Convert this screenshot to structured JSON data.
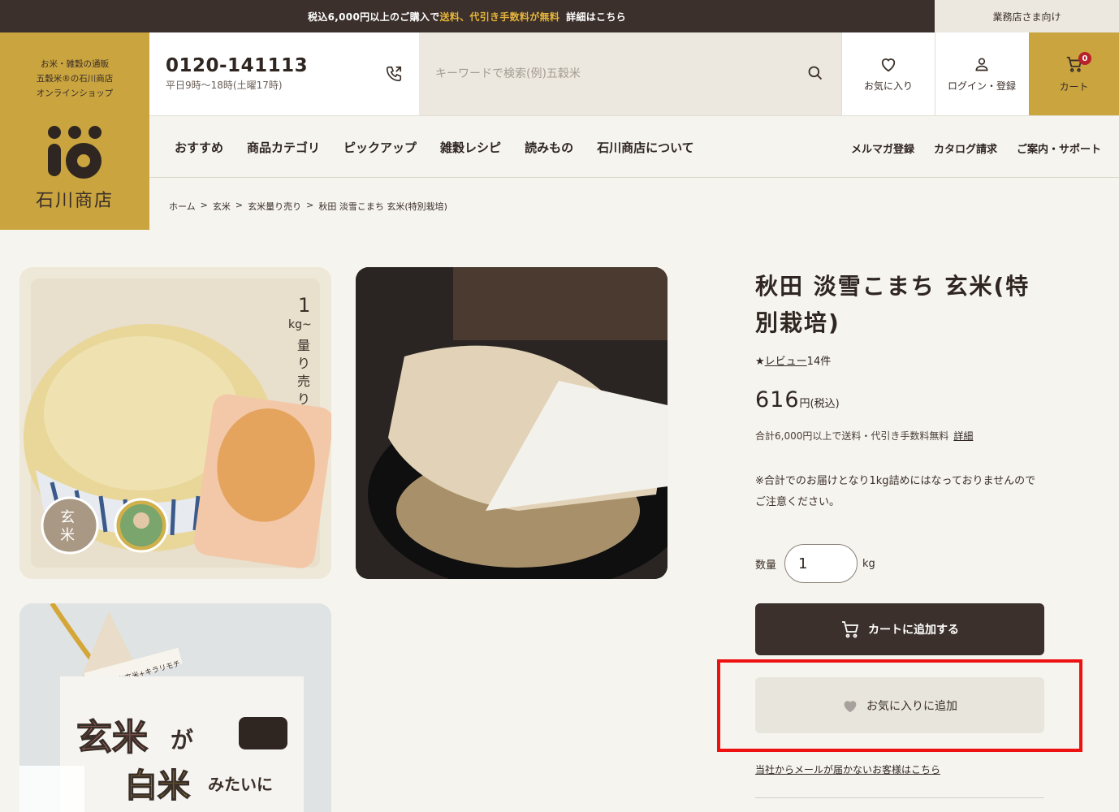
{
  "topbar": {
    "promo_a": "税込6,000円以上のご購入で",
    "promo_b": "送料、代引き手数料が無料",
    "promo_c": "詳細はこちら",
    "business": "業務店さま向け"
  },
  "logo": {
    "tagline1": "お米・雑穀の通販",
    "tagline2": "五穀米®の石川商店",
    "tagline3": "オンラインショップ",
    "name": "石川商店"
  },
  "header": {
    "phone": "0120-141113",
    "hours": "平日9時～18時(土曜17時)",
    "search_placeholder": "キーワードで検索(例)五穀米",
    "favorites": "お気に入り",
    "login": "ログイン・登録",
    "cart": "カート",
    "cart_count": "0"
  },
  "nav": {
    "main": [
      "おすすめ",
      "商品カテゴリ",
      "ピックアップ",
      "雑穀レシピ",
      "読みもの",
      "石川商店について"
    ],
    "sub": [
      "メルマガ登録",
      "カタログ請求",
      "ご案内・サポート"
    ]
  },
  "breadcrumb": [
    "ホーム",
    ">",
    "玄米",
    ">",
    "玄米量り売り",
    ">",
    "秋田 淡雪こまち 玄米(特別栽培)"
  ],
  "gallery": {
    "img1_side": "1kg~量り売り",
    "img1_badge": "玄米",
    "img3_top": "淡雪こまち玄米+キラリモチ",
    "img3_main1": "玄米",
    "img3_main2": "が",
    "img3_main3": "白米",
    "img3_main4": "みたいに"
  },
  "product": {
    "title": "秋田 淡雪こまち 玄米(特別栽培)",
    "review_star": "★",
    "review_label": "レビュー",
    "review_count": "14件",
    "price": "616",
    "price_unit": "円(税込)",
    "shipping_note": "合計6,000円以上で送料・代引き手数料無料",
    "shipping_link": "詳細",
    "note": "※合計でのお届けとなり1kg詰めにはなっておりませんのでご注意ください。",
    "qty_label": "数量",
    "qty_value": "1",
    "qty_unit": "kg",
    "add_cart": "カートに追加する",
    "add_fav": "お気に入りに追加",
    "mail_link": "当社からメールが届かないお客様はこちら"
  },
  "colors": {
    "topbar": "#3b302b",
    "gold": "#c9a43f",
    "highlight": "#e5b43a",
    "cart_badge": "#b8222a",
    "annotation": "#ee1111"
  }
}
